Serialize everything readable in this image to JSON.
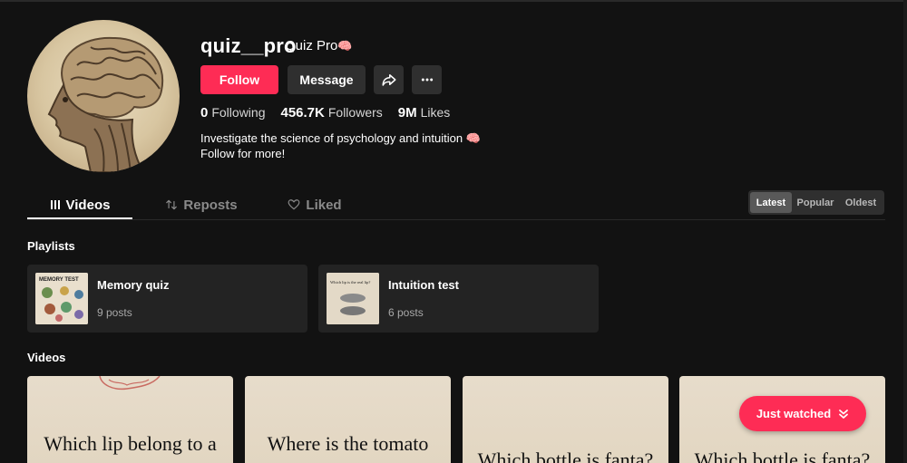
{
  "profile": {
    "username": "quiz__pro",
    "nickname": "Quiz Pro",
    "nickname_emoji": "🧠",
    "follow_label": "Follow",
    "message_label": "Message",
    "stats": {
      "following_count": "0",
      "following_label": "Following",
      "followers_count": "456.7K",
      "followers_label": "Followers",
      "likes_count": "9M",
      "likes_label": "Likes"
    },
    "bio_line1": "Investigate the science of psychology and intuition 🧠",
    "bio_line2": "Follow for more!"
  },
  "tabs": {
    "videos": "Videos",
    "reposts": "Reposts",
    "liked": "Liked"
  },
  "sort": {
    "latest": "Latest",
    "popular": "Popular",
    "oldest": "Oldest",
    "selected": "Latest"
  },
  "sections": {
    "playlists": "Playlists",
    "videos": "Videos"
  },
  "playlists": [
    {
      "name": "Memory quiz",
      "count": "9 posts",
      "thumb_caption": "MEMORY TEST"
    },
    {
      "name": "Intuition test",
      "count": "6 posts",
      "thumb_caption": "Which lip is the real lip?"
    }
  ],
  "videos": [
    {
      "title": "Which lip belong to a"
    },
    {
      "title": "Where is the tomato"
    },
    {
      "title": "Which bottle is fanta?"
    },
    {
      "title": "Which bottle is fanta?"
    }
  ],
  "just_watched_label": "Just watched",
  "colors": {
    "accent": "#fe2c55",
    "background": "#121212",
    "card": "#232323"
  },
  "icons": {
    "share": "share-arrow-icon",
    "more": "more-dots-icon",
    "videos_tab": "grid-bars-icon",
    "reposts_tab": "repost-icon",
    "liked_tab": "heart-outline-icon",
    "just_watched": "double-chevron-down-icon"
  }
}
